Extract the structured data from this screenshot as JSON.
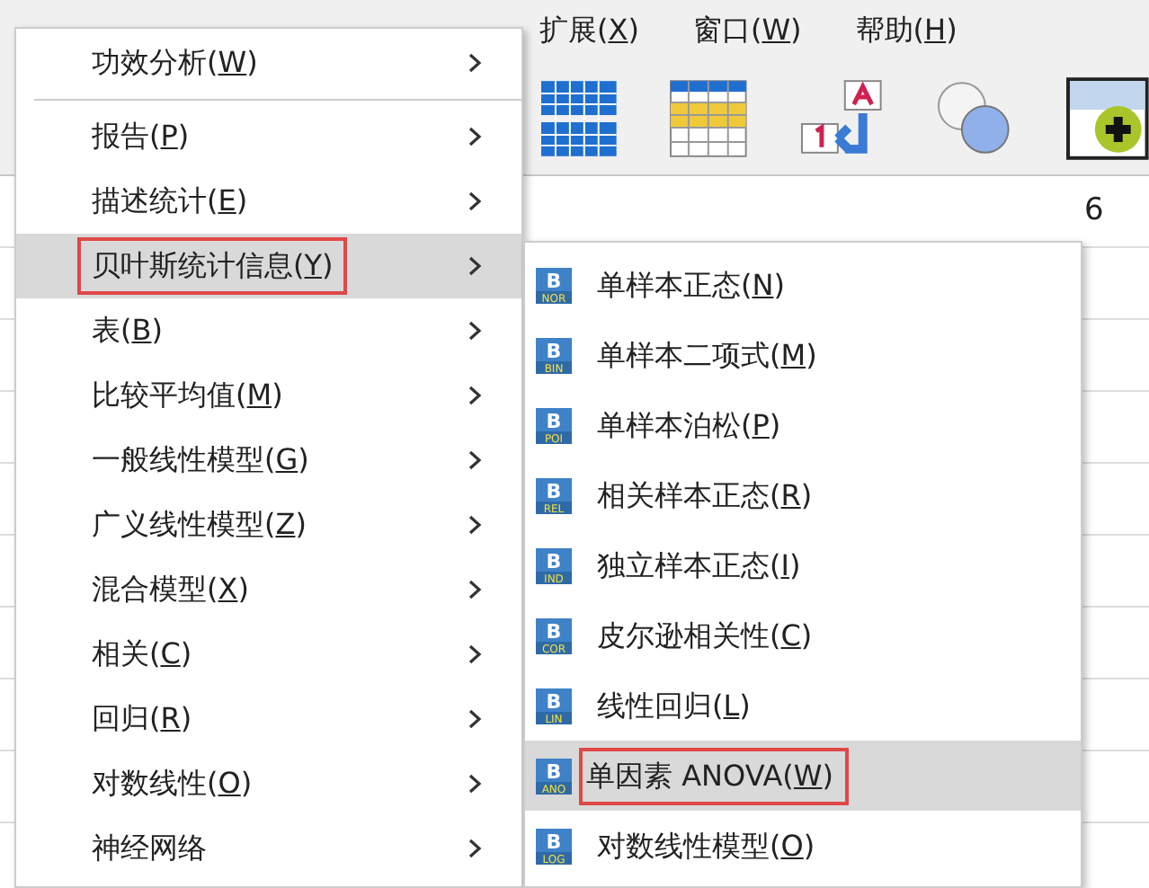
{
  "menubar": [
    {
      "before": "扩展(",
      "accel": "X",
      "after": ")"
    },
    {
      "before": "窗口(",
      "accel": "W",
      "after": ")"
    },
    {
      "before": "帮助(",
      "accel": "H",
      "after": ")"
    }
  ],
  "grid": {
    "cell": "6"
  },
  "menu": [
    {
      "before": "功效分析(",
      "accel": "W",
      "after": ")",
      "selected": false,
      "separator_after": true
    },
    {
      "before": "报告(",
      "accel": "P",
      "after": ")",
      "selected": false
    },
    {
      "before": "描述统计(",
      "accel": "E",
      "after": ")",
      "selected": false
    },
    {
      "before": "贝叶斯统计信息(",
      "accel": "Y",
      "after": ")",
      "selected": true
    },
    {
      "before": "表(",
      "accel": "B",
      "after": ")",
      "selected": false
    },
    {
      "before": "比较平均值(",
      "accel": "M",
      "after": ")",
      "selected": false
    },
    {
      "before": "一般线性模型(",
      "accel": "G",
      "after": ")",
      "selected": false
    },
    {
      "before": "广义线性模型(",
      "accel": "Z",
      "after": ")",
      "selected": false
    },
    {
      "before": "混合模型(",
      "accel": "X",
      "after": ")",
      "selected": false
    },
    {
      "before": "相关(",
      "accel": "C",
      "after": ")",
      "selected": false
    },
    {
      "before": "回归(",
      "accel": "R",
      "after": ")",
      "selected": false
    },
    {
      "before": "对数线性(",
      "accel": "O",
      "after": ")",
      "selected": false
    },
    {
      "before": "神经网络",
      "selected": false
    }
  ],
  "submenu": [
    {
      "before": "单样本正态(",
      "accel": "N",
      "after": ")",
      "icon_letter": "B",
      "icon_tag": "NOR",
      "selected": false
    },
    {
      "before": "单样本二项式(",
      "accel": "M",
      "after": ")",
      "icon_letter": "B",
      "icon_tag": "BIN",
      "selected": false
    },
    {
      "before": "单样本泊松(",
      "accel": "P",
      "after": ")",
      "icon_letter": "B",
      "icon_tag": "POI",
      "selected": false
    },
    {
      "before": "相关样本正态(",
      "accel": "R",
      "after": ")",
      "icon_letter": "B",
      "icon_tag": "REL",
      "selected": false
    },
    {
      "before": "独立样本正态(",
      "accel": "I",
      "after": ")",
      "icon_letter": "B",
      "icon_tag": "IND",
      "selected": false
    },
    {
      "before": "皮尔逊相关性(",
      "accel": "C",
      "after": ")",
      "icon_letter": "B",
      "icon_tag": "COR",
      "selected": false
    },
    {
      "before": "线性回归(",
      "accel": "L",
      "after": ")",
      "icon_letter": "B",
      "icon_tag": "LIN",
      "selected": false
    },
    {
      "before": "单因素 ANOVA(",
      "accel": "W",
      "after": ")",
      "icon_letter": "B",
      "icon_tag": "ANO",
      "selected": true
    },
    {
      "before": "对数线性模型(",
      "accel": "O",
      "after": ")",
      "icon_letter": "B",
      "icon_tag": "LOG",
      "selected": false
    }
  ]
}
